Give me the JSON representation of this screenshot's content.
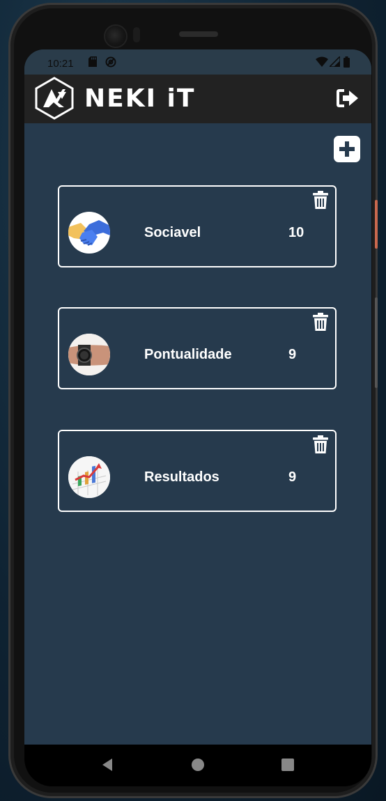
{
  "status_bar": {
    "time": "10:21",
    "left_icons": [
      "sd-card-icon",
      "at-sign-icon"
    ],
    "right_icons": [
      "wifi-icon",
      "signal-icon",
      "battery-icon"
    ]
  },
  "app_bar": {
    "brand": "NEKI iT",
    "logo_icon": "neki-logo-icon",
    "logout_icon": "logout-icon"
  },
  "actions": {
    "add_icon": "plus-square-icon"
  },
  "skills": [
    {
      "name": "Sociavel",
      "score": "10",
      "image": "handshake"
    },
    {
      "name": "Pontualidade",
      "score": "9",
      "image": "wristwatch"
    },
    {
      "name": "Resultados",
      "score": "9",
      "image": "growth-chart"
    }
  ],
  "nav_bar": {
    "icons": [
      "back-icon",
      "home-icon",
      "recents-icon"
    ]
  },
  "colors": {
    "background": "#263a4d",
    "app_bar": "#222222",
    "accent": "#ffffff"
  }
}
